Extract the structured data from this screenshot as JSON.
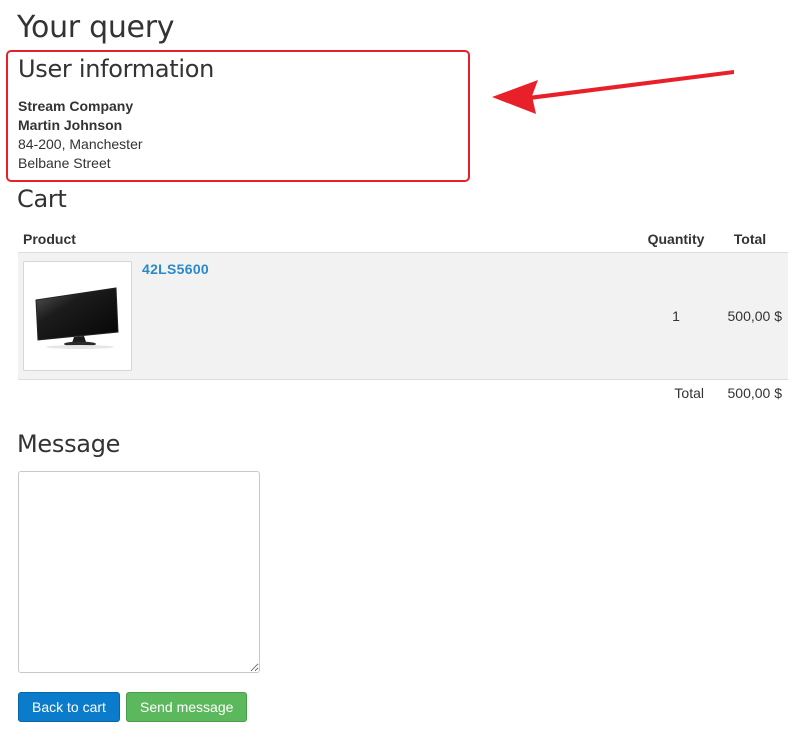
{
  "page": {
    "title": "Your query"
  },
  "user_info": {
    "title": "User information",
    "company": "Stream Company",
    "name": "Martin Johnson",
    "address_line": "84-200, Manchester",
    "street": "Belbane Street"
  },
  "cart": {
    "title": "Cart",
    "columns": {
      "product": "Product",
      "quantity": "Quantity",
      "total": "Total"
    },
    "items": [
      {
        "name": "42LS5600",
        "quantity": "1",
        "total": "500,00 $",
        "image_icon": "tv-icon"
      }
    ],
    "total_label": "Total",
    "total_value": "500,00 $"
  },
  "message": {
    "title": "Message",
    "value": ""
  },
  "buttons": {
    "back": "Back to cart",
    "send": "Send message"
  },
  "colors": {
    "highlight": "#e8202a",
    "link": "#2a8ac8",
    "primary_button": "#0b7bcc",
    "success_button": "#5cb85c"
  }
}
